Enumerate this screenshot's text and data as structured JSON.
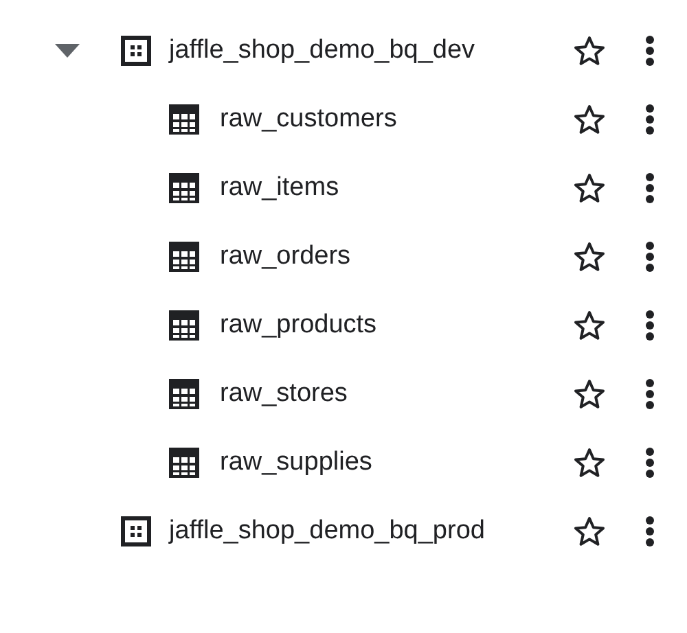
{
  "datasets": [
    {
      "name": "jaffle_shop_demo_bq_dev",
      "expanded": true,
      "starred": false,
      "children": [
        {
          "name": "raw_customers",
          "starred": false
        },
        {
          "name": "raw_items",
          "starred": false
        },
        {
          "name": "raw_orders",
          "starred": false
        },
        {
          "name": "raw_products",
          "starred": false
        },
        {
          "name": "raw_stores",
          "starred": false
        },
        {
          "name": "raw_supplies",
          "starred": false
        }
      ]
    },
    {
      "name": "jaffle_shop_demo_bq_prod",
      "expanded": false,
      "starred": false
    }
  ]
}
